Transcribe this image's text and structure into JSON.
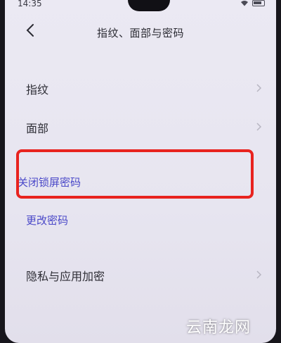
{
  "status_bar": {
    "time": "14:35"
  },
  "header": {
    "title": "指纹、面部与密码"
  },
  "items": [
    {
      "label": "指纹"
    },
    {
      "label": "面部"
    },
    {
      "label": "关闭锁屏密码"
    },
    {
      "label": "更改密码"
    },
    {
      "label": "隐私与应用加密"
    }
  ],
  "colors": {
    "accent": "#4a48c8",
    "highlight": "#e8231f"
  },
  "watermark": "云南龙网"
}
